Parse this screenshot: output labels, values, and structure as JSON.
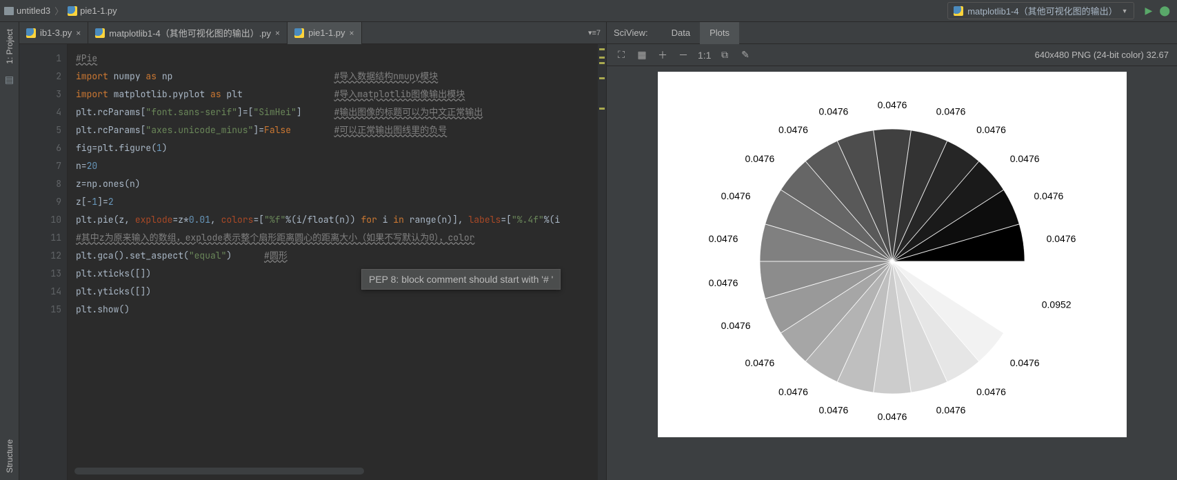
{
  "breadcrumb": {
    "project": "untitled3",
    "file": "pie1-1.py"
  },
  "run_config": {
    "label": "matplotlib1-4（其他可视化图的输出）"
  },
  "side_rail": {
    "top_label": "1: Project",
    "bottom_label": "Structure"
  },
  "editor_tabs": {
    "items": [
      {
        "label": "ib1-3.py",
        "active": false
      },
      {
        "label": "matplotlib1-4（其他可视化图的输出）.py",
        "active": false
      },
      {
        "label": "pie1-1.py",
        "active": true
      }
    ],
    "right_indicator": "▾≡7"
  },
  "code": {
    "lines": [
      {
        "n": 1,
        "raw": "#Pie"
      },
      {
        "n": 2,
        "raw": "import numpy as np                              #导入数据结构nmupy模块"
      },
      {
        "n": 3,
        "raw": "import matplotlib.pyplot as plt                 #导入matplotlib图像输出模块"
      },
      {
        "n": 4,
        "raw": "plt.rcParams[\"font.sans-serif\"]=[\"SimHei\"]      #输出图像的标题可以为中文正常输出"
      },
      {
        "n": 5,
        "raw": "plt.rcParams[\"axes.unicode_minus\"]=False        #可以正常输出图线里的负号"
      },
      {
        "n": 6,
        "raw": "fig=plt.figure(1)"
      },
      {
        "n": 7,
        "raw": "n=20"
      },
      {
        "n": 8,
        "raw": "z=np.ones(n)"
      },
      {
        "n": 9,
        "raw": "z[-1]=2"
      },
      {
        "n": 10,
        "raw": "plt.pie(z, explode=z*0.01, colors=[\"%f\"%(i/float(n)) for i in range(n)], labels=[\"%.4f\"%(i"
      },
      {
        "n": 11,
        "raw": "#其中z为原来输入的数组，explode表示整个扇形距离圆心的距离大小（如果不写默认为0），color"
      },
      {
        "n": 12,
        "raw": "plt.gca().set_aspect(\"equal\")      #圆形"
      },
      {
        "n": 13,
        "raw": "plt.xticks([])"
      },
      {
        "n": 14,
        "raw": "plt.yticks([])"
      },
      {
        "n": 15,
        "raw": "plt.show()"
      }
    ]
  },
  "tooltip": {
    "text": "PEP 8: block comment should start with '# '"
  },
  "sciview": {
    "title": "SciView:",
    "tabs": [
      {
        "label": "Data",
        "active": false
      },
      {
        "label": "Plots",
        "active": true
      }
    ],
    "status": "640x480 PNG (24-bit color) 32.67"
  },
  "chart_data": {
    "type": "pie",
    "title": "",
    "n_slices": 21,
    "values": [
      1,
      1,
      1,
      1,
      1,
      1,
      1,
      1,
      1,
      1,
      1,
      1,
      1,
      1,
      1,
      1,
      1,
      1,
      1,
      1,
      2
    ],
    "labels": [
      "0.0476",
      "0.0476",
      "0.0476",
      "0.0476",
      "0.0476",
      "0.0476",
      "0.0476",
      "0.0476",
      "0.0476",
      "0.0476",
      "0.0476",
      "0.0476",
      "0.0476",
      "0.0476",
      "0.0476",
      "0.0476",
      "0.0476",
      "0.0476",
      "0.0476",
      "0.0476",
      "0.0952"
    ],
    "colors_gray_fraction": [
      "0.000000",
      "0.050000",
      "0.100000",
      "0.150000",
      "0.200000",
      "0.250000",
      "0.300000",
      "0.350000",
      "0.400000",
      "0.450000",
      "0.500000",
      "0.550000",
      "0.600000",
      "0.650000",
      "0.700000",
      "0.750000",
      "0.800000",
      "0.850000",
      "0.900000",
      "0.950000",
      "1.000000"
    ],
    "explode_each": 0.01
  }
}
